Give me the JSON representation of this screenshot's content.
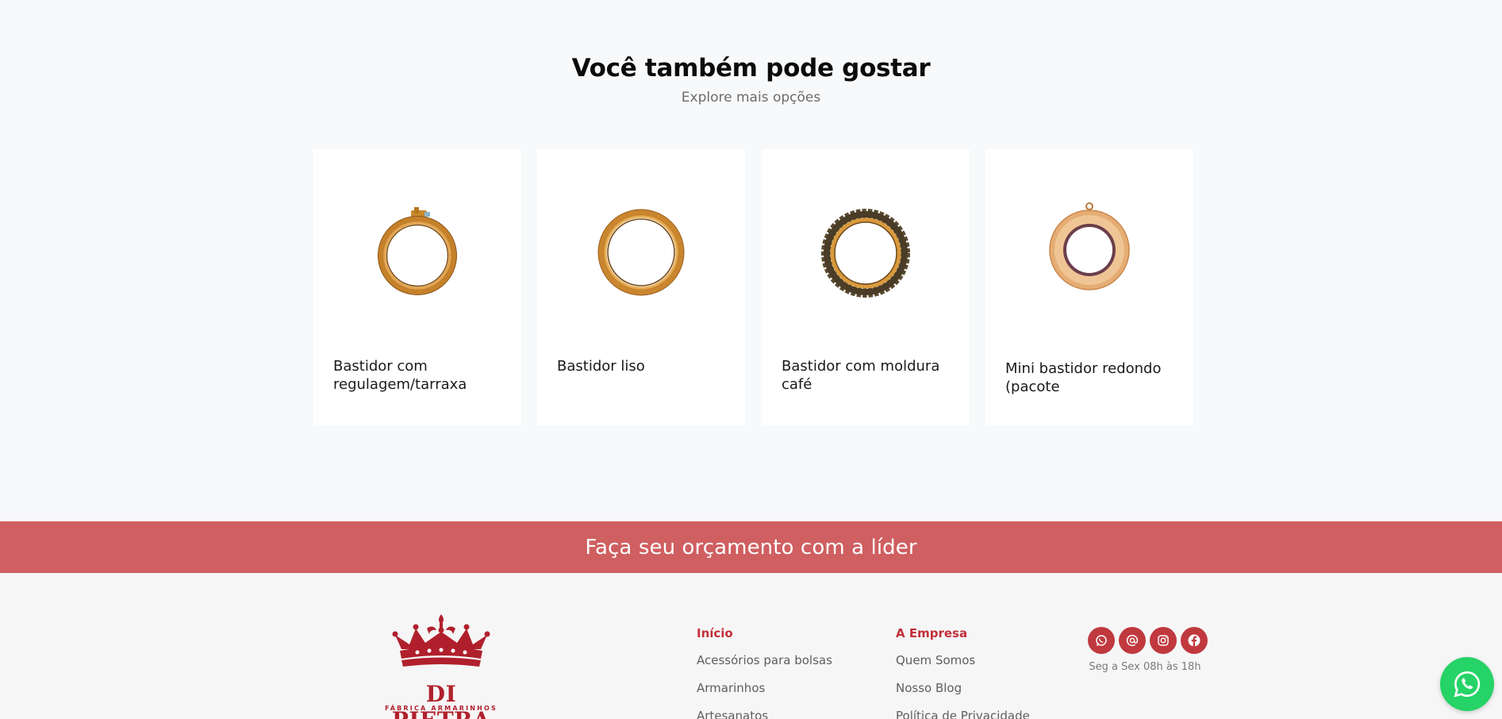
{
  "related": {
    "title": "Você também pode gostar",
    "subtitle": "Explore mais opções",
    "products": [
      {
        "name": "Bastidor com regulagem/tarraxa",
        "image": "embroidery-hoop-with-screw"
      },
      {
        "name": "Bastidor liso",
        "image": "plain-embroidery-hoop"
      },
      {
        "name": "Bastidor com moldura café",
        "image": "embroidery-hoop-coffee-frame"
      },
      {
        "name": "Mini bastidor redondo (pacote",
        "image": "mini-round-hoop"
      }
    ]
  },
  "cta": {
    "label": "Faça seu orçamento com a líder"
  },
  "footer": {
    "logo": {
      "name": "DI PIETRA",
      "tagline": "FÁBRICA ARMARINHOS",
      "icon": "crown-icon"
    },
    "col1": {
      "title": "Início",
      "links": [
        "Acessórios para bolsas",
        "Armarinhos",
        "Artesanatos"
      ]
    },
    "col2": {
      "title": "A Empresa",
      "links": [
        "Quem Somos",
        "Nosso Blog",
        "Política de Privacidade"
      ]
    },
    "social": [
      "whatsapp-icon",
      "email-at-icon",
      "instagram-icon",
      "facebook-icon"
    ],
    "hours": "Seg a Sex 08h às 18h"
  },
  "floating": {
    "icon": "whatsapp-icon"
  },
  "colors": {
    "accent": "#cf5f61",
    "brand_red": "#b0202c",
    "social_bg": "#c0393f",
    "whatsapp": "#25d366",
    "page_bg": "#f8f9fa"
  }
}
